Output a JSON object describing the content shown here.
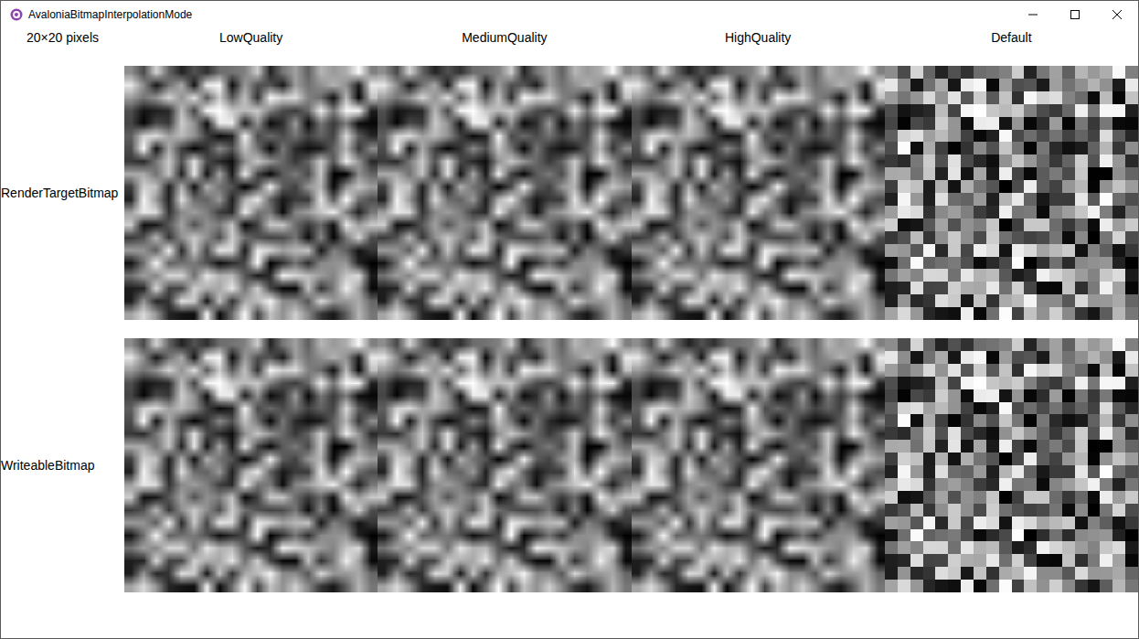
{
  "window": {
    "title": "AvaloniaBitmapInterpolationMode"
  },
  "corner_label": "20×20 pixels",
  "columns": [
    {
      "label": "LowQuality",
      "smooth": true
    },
    {
      "label": "MediumQuality",
      "smooth": true
    },
    {
      "label": "HighQuality",
      "smooth": true
    },
    {
      "label": "Default",
      "smooth": false
    }
  ],
  "rows": [
    {
      "label": "RenderTargetBitmap"
    },
    {
      "label": "WriteableBitmap"
    }
  ]
}
